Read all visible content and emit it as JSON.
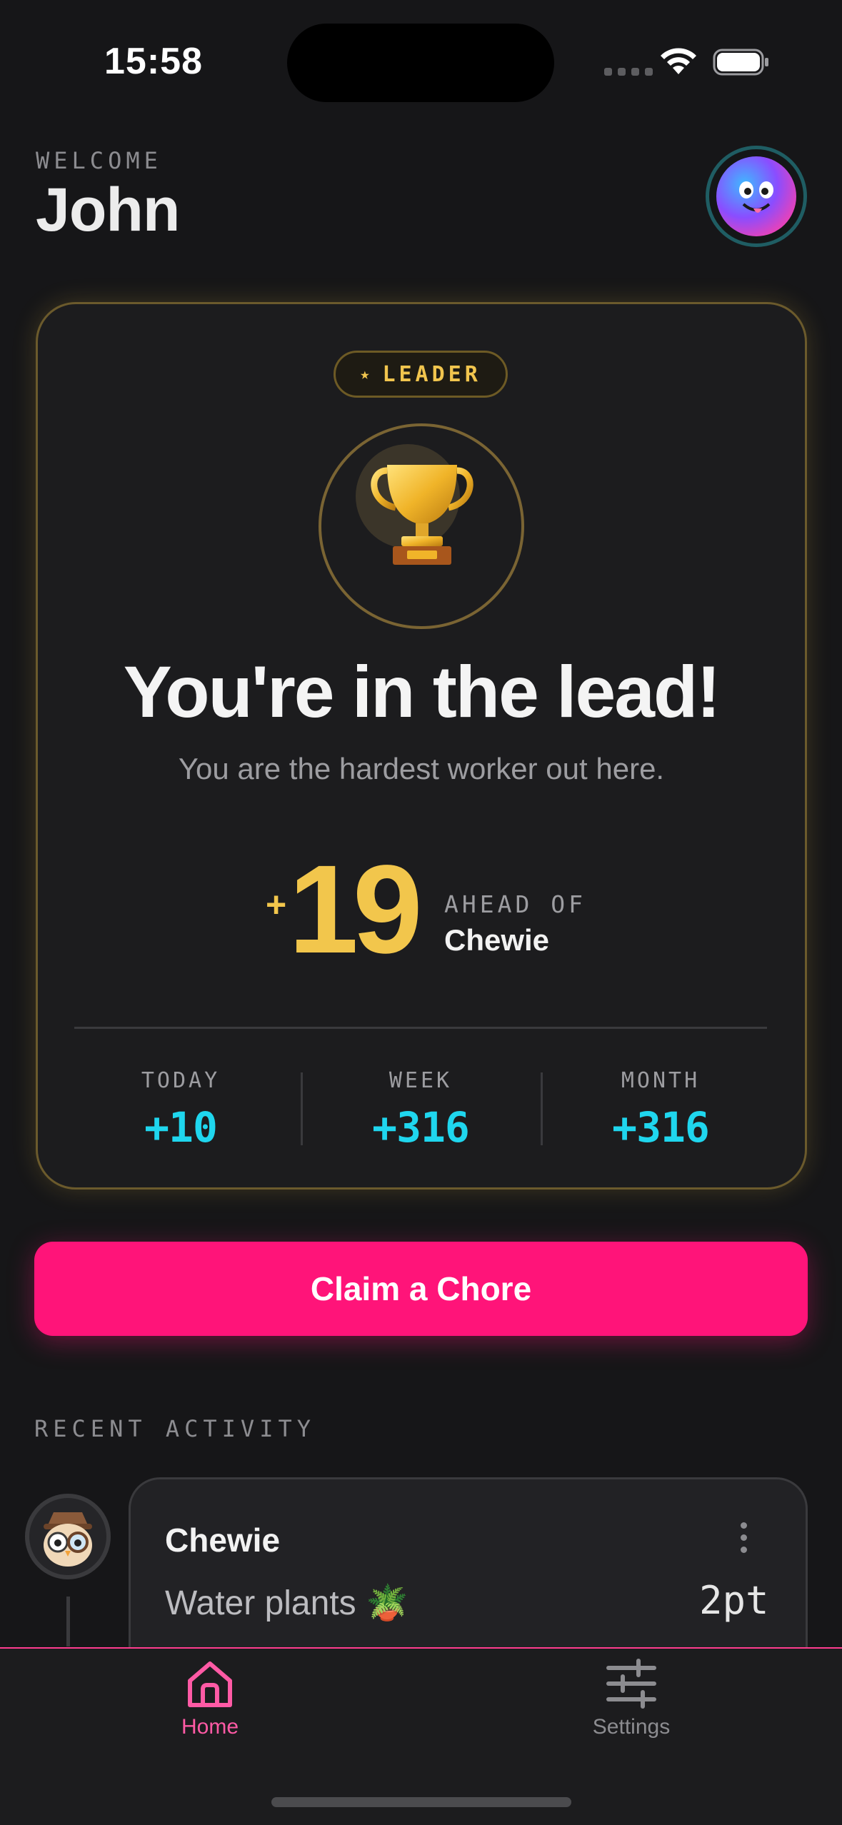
{
  "status_bar": {
    "time": "15:58"
  },
  "header": {
    "welcome_label": "WELCOME",
    "user_name": "John",
    "avatar_icon": "purple-blob-monster-avatar"
  },
  "leader_card": {
    "badge": {
      "star": "★",
      "label": "LEADER"
    },
    "trophy_icon": "trophy-icon",
    "headline": "You're in the lead!",
    "subline": "You are the hardest worker out here.",
    "lead": {
      "plus": "+",
      "value": "19",
      "ahead_label": "AHEAD OF",
      "ahead_name": "Chewie"
    },
    "stats": [
      {
        "label": "TODAY",
        "value": "+10"
      },
      {
        "label": "WEEK",
        "value": "+316"
      },
      {
        "label": "MONTH",
        "value": "+316"
      }
    ]
  },
  "claim_button": {
    "label": "Claim a Chore"
  },
  "recent_activity": {
    "title": "RECENT ACTIVITY",
    "items": [
      {
        "user": "Chewie",
        "chore": "Water plants 🪴",
        "points": "2pt",
        "avatar_icon": "owl-detective-avatar"
      }
    ]
  },
  "tabs": [
    {
      "label": "Home",
      "icon": "home-icon",
      "active": true
    },
    {
      "label": "Settings",
      "icon": "sliders-icon",
      "active": false
    }
  ],
  "colors": {
    "background": "#161618",
    "card": "#1c1c1e",
    "gold": "#f2c64c",
    "cyan": "#1fd6ee",
    "pink": "#ff1479",
    "tab_active": "#ff5aa5",
    "tab_inactive": "#8c8c90"
  }
}
